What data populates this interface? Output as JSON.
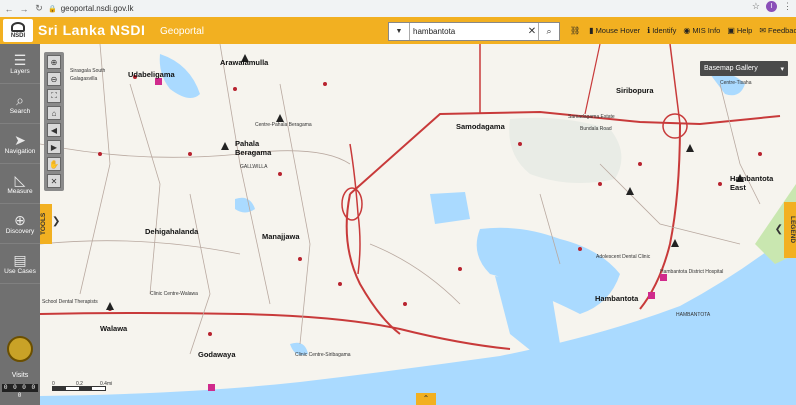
{
  "browser": {
    "url": "geoportal.nsdi.gov.lk",
    "back": "←",
    "forward": "→",
    "reload": "↻",
    "lock": "🔒",
    "star": "☆",
    "avatar": "I",
    "menu": "⋮"
  },
  "header": {
    "logo_text": "NSDI",
    "title": "Sri Lanka NSDI",
    "subtitle": "Geoportal",
    "search": {
      "value": "hambantota",
      "clear": "✕"
    },
    "tools": [
      {
        "icon": "link-icon",
        "glyph": "⛓",
        "label": ""
      },
      {
        "icon": "mouse-hover-icon",
        "glyph": "▮",
        "label": "Mouse Hover"
      },
      {
        "icon": "identify-icon",
        "glyph": "ℹ",
        "label": "Identify"
      },
      {
        "icon": "mis-info-icon",
        "glyph": "◉",
        "label": "MIS Info"
      },
      {
        "icon": "help-icon",
        "glyph": "▣",
        "label": "Help"
      },
      {
        "icon": "feedback-icon",
        "glyph": "✉",
        "label": "Feedback"
      }
    ]
  },
  "sidebar": {
    "items": [
      {
        "icon": "layers-icon",
        "glyph": "☰",
        "label": "Layers"
      },
      {
        "icon": "search-icon",
        "glyph": "⌕",
        "label": "Search"
      },
      {
        "icon": "navigation-icon",
        "glyph": "➤",
        "label": "Navigation"
      },
      {
        "icon": "measure-icon",
        "glyph": "◺",
        "label": "Measure"
      },
      {
        "icon": "discovery-icon",
        "glyph": "⊕",
        "label": "Discovery"
      },
      {
        "icon": "use-cases-icon",
        "glyph": "▤",
        "label": "Use Cases"
      }
    ],
    "visits_label": "Visits",
    "visits_count": "0 0 0 0 0"
  },
  "map": {
    "tools_label": "TOOLS",
    "legend_label": "LEGEND",
    "basemap_label": "Basemap Gallery",
    "scale_labels": [
      "0",
      "0.2",
      "0.4mi"
    ],
    "places_major": [
      "Udabeligama",
      "Arawalamulla",
      "Pahala Beragama",
      "Siribopura",
      "Samodagama",
      "Hambantota East",
      "Dehigahalanda",
      "Manajjawa",
      "Walawa",
      "Godawaya",
      "Hambantota"
    ],
    "places_minor": [
      "Sirasgala South",
      "Galagasvilla",
      "Dehigahalanda",
      "Centre-Pahala Beragama",
      "GALLWILLA",
      "Samadagama Estate",
      "Bundala Road",
      "Centre-Tisaha",
      "Adolescent Dental Clinic",
      "Hambantota District Hospital",
      "Clinic Centre-Walawa",
      "Clinic Centre-Siribagama",
      "School Dental Therapists",
      "HAMBANTOTA"
    ]
  }
}
